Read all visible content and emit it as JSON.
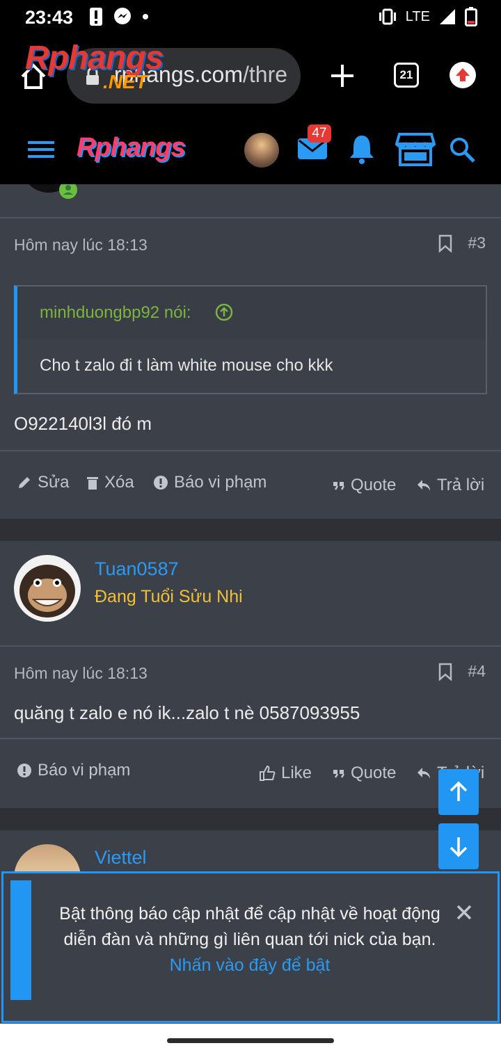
{
  "status_bar": {
    "time": "23:43",
    "network": "LTE"
  },
  "browser": {
    "url_host": "rphangs.com",
    "url_path": "/thre",
    "tab_count": "21",
    "watermark_logo": "Rphangs",
    "watermark_suffix": ".NET"
  },
  "site_header": {
    "logo": "Rphangs",
    "mail_badge": "47"
  },
  "post3": {
    "date": "Hôm nay lúc 18:13",
    "number": "#3",
    "quote_author": "minhduongbp92 nói:",
    "quote_text": "Cho t zalo đi t làm white mouse cho kkk",
    "text": "O922140l3l đó m",
    "actions": {
      "edit": "Sửa",
      "delete": "Xóa",
      "report": "Báo vi phạm",
      "quote": "Quote",
      "reply": "Trả lời"
    }
  },
  "post4": {
    "username": "Tuan0587",
    "user_title": "Đang Tuổi Sửu Nhi",
    "date": "Hôm nay lúc 18:13",
    "number": "#4",
    "text": "quăng t zalo e nó ik...zalo t nè 0587093955",
    "actions": {
      "report": "Báo vi phạm",
      "like": "Like",
      "quote": "Quote",
      "reply": "Trả lời"
    }
  },
  "post5": {
    "username": "Viettel"
  },
  "notification": {
    "message": "Bật thông báo cập nhật để cập nhật về hoạt động diễn đàn và những gì liên quan tới nick của bạn.",
    "link": "Nhấn vào đây để bật"
  },
  "colors": {
    "accent": "#2196f3",
    "username": "#2b9af3",
    "user_title": "#f2c037",
    "quote_author": "#7cb342",
    "badge": "#e53935"
  }
}
